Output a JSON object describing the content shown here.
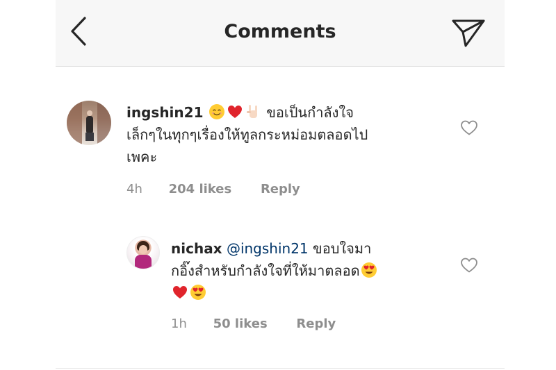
{
  "header": {
    "title": "Comments",
    "back_icon": "chevron-left-icon",
    "send_icon": "paper-plane-icon"
  },
  "comments": [
    {
      "username": "ingshin21",
      "text_prefix_emojis": [
        "smiling-face",
        "red-heart",
        "sign-of-horns"
      ],
      "text_line1": "ขอเป็นกำลังใจ",
      "text_line2": "เล็กๆในทุกๆเรื่องให้ทูลกระหม่อมตลอดไป",
      "text_line3": "เพคะ",
      "time": "4h",
      "likes": "204 likes",
      "reply": "Reply"
    },
    {
      "username": "nichax",
      "mention": "@ingshin21",
      "text_line1": "ขอบใจมา",
      "text_line2": "กอิ๊งสำหรับกำลังใจที่ให้มาตลอด",
      "trailing_emojis": [
        "heart-eyes",
        "red-heart",
        "heart-eyes"
      ],
      "time": "1h",
      "likes": "50 likes",
      "reply": "Reply"
    }
  ],
  "colors": {
    "header_bg": "#f7f7f7",
    "text": "#262626",
    "meta": "#8e8e8e",
    "mention": "#003569"
  }
}
